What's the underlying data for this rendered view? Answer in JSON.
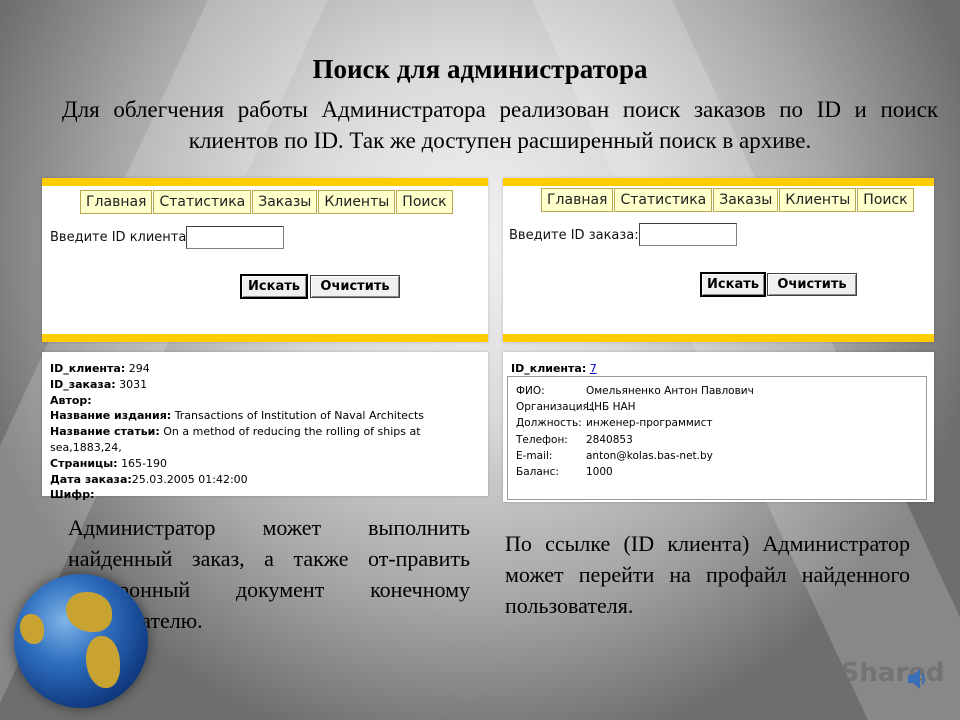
{
  "slide": {
    "title": "Поиск для администратора",
    "subtitle": "Для облегчения работы Администратора реализован поиск заказов по ID и поиск клиентов по ID. Так же доступен расширенный поиск в архиве.",
    "left_text": "Администратор может выполнить найденный заказ, а также от-править электронный документ конечному пользователю.",
    "right_text": "По ссылке (ID клиента) Администратор может перейти на профайл найденного пользователя.",
    "logo": "MyShared"
  },
  "left_panel": {
    "tabs": [
      "Главная",
      "Статистика",
      "Заказы",
      "Клиенты",
      "Поиск"
    ],
    "field_label": "Введите ID клиента:",
    "field_value": "",
    "search_button": "Искать",
    "clear_button": "Очистить"
  },
  "right_panel": {
    "tabs": [
      "Главная",
      "Статистика",
      "Заказы",
      "Клиенты",
      "Поиск"
    ],
    "field_label": "Введите ID заказа:",
    "field_value": "",
    "search_button": "Искать",
    "clear_button": "Очистить"
  },
  "order_record": {
    "client_id_label": "ID_клиента:",
    "client_id": "294",
    "order_id_label": "ID_заказа:",
    "order_id": "3031",
    "author_label": "Автор:",
    "author": "",
    "edition_label": "Название издания:",
    "edition": "Transactions of Institution of Naval Architects",
    "article_label": "Название статьи:",
    "article": "On a method of reducing the rolling of ships at sea,1883,24,",
    "pages_label": "Страницы:",
    "pages": "165-190",
    "date_label": "Дата заказа:",
    "date": "25.03.2005 01:42:00",
    "cipher_label": "Шифр:",
    "cipher": ""
  },
  "client_record": {
    "id_label": "ID_клиента:",
    "id_link": "7",
    "rows": [
      {
        "k": "ФИО:",
        "v": "Омельяненко Антон Павлович"
      },
      {
        "k": "Организация:",
        "v": "ЦНБ НАН"
      },
      {
        "k": "Должность:",
        "v": "инженер-программист"
      },
      {
        "k": "Телефон:",
        "v": "2840853"
      },
      {
        "k": "E-mail:",
        "v": "anton@kolas.bas-net.by"
      },
      {
        "k": "Баланс:",
        "v": "1000"
      }
    ]
  },
  "colors": {
    "tab_bg": "#ffffcc",
    "bar": "#ffcc00",
    "link": "#0000cc"
  }
}
